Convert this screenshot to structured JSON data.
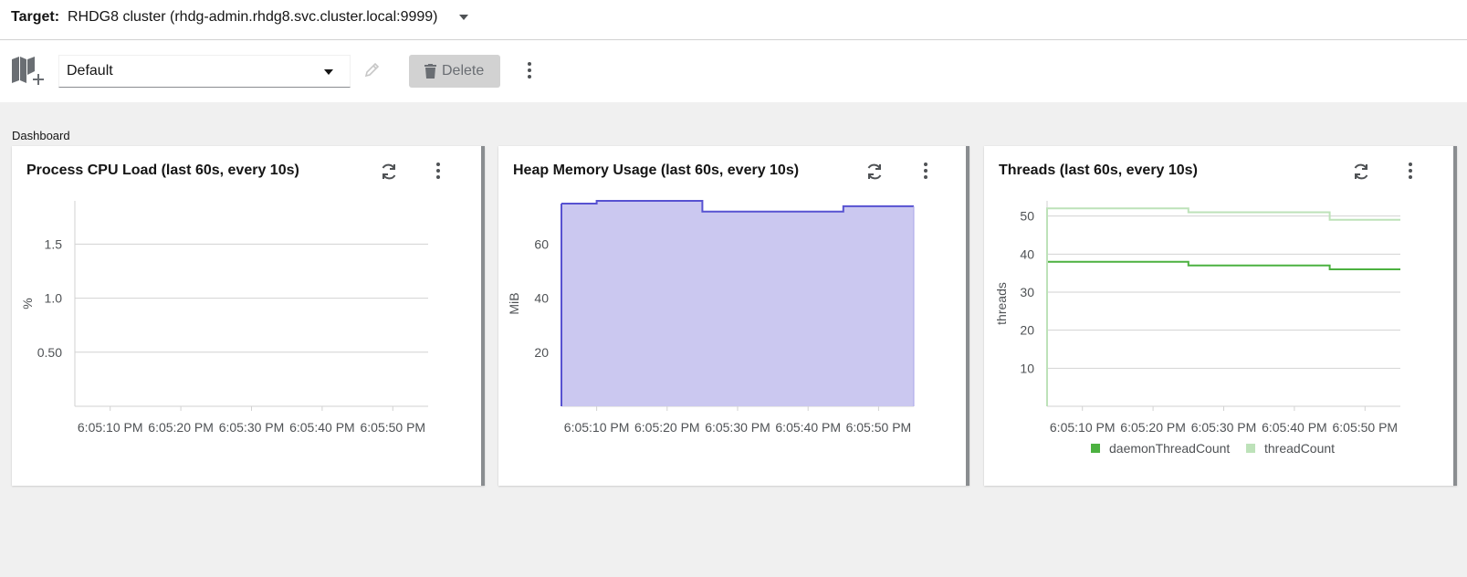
{
  "target": {
    "label": "Target:",
    "value": "RHDG8 cluster (rhdg-admin.rhdg8.svc.cluster.local:9999)"
  },
  "toolbar": {
    "layout_value": "Default",
    "delete_label": "Delete"
  },
  "dashboard_label": "Dashboard",
  "icons": [
    "layout-library-icon",
    "caret-down-icon",
    "pencil-icon",
    "trash-icon",
    "kebab-icon",
    "refresh-icon"
  ],
  "colors": {
    "heap_fill": "#cbc8f0",
    "heap_line": "#5752d1",
    "daemon_threads": "#4cb140",
    "thread_count": "#bde2b9",
    "disabled_button": "#d2d2d2"
  },
  "cards": [
    {
      "title": "Process CPU Load (last 60s, every 10s)"
    },
    {
      "title": "Heap Memory Usage (last 60s, every 10s)"
    },
    {
      "title": "Threads (last 60s, every 10s)"
    }
  ],
  "chart_data": [
    {
      "type": "line",
      "title": "Process CPU Load (last 60s, every 10s)",
      "ylabel": "%",
      "yticks": [
        "0.50",
        "1.0",
        "1.5"
      ],
      "ytick_values": [
        0.5,
        1.0,
        1.5
      ],
      "ylim": [
        0,
        1.9
      ],
      "xticks": [
        "6:05:10 PM",
        "6:05:20 PM",
        "6:05:30 PM",
        "6:05:40 PM",
        "6:05:50 PM"
      ],
      "xlim": [
        "6:05:05 PM",
        "6:05:55 PM"
      ],
      "grid": true,
      "series": []
    },
    {
      "type": "area",
      "title": "Heap Memory Usage (last 60s, every 10s)",
      "ylabel": "MiB",
      "yticks": [
        "20",
        "40",
        "60"
      ],
      "ytick_values": [
        20,
        40,
        60
      ],
      "ylim": [
        0,
        76
      ],
      "xticks": [
        "6:05:10 PM",
        "6:05:20 PM",
        "6:05:30 PM",
        "6:05:40 PM",
        "6:05:50 PM"
      ],
      "xlim": [
        "6:05:05 PM",
        "6:05:55 PM"
      ],
      "grid": true,
      "interpolation": "step",
      "series": [
        {
          "x": [
            "6:05:05 PM",
            "6:05:10 PM",
            "6:05:20 PM",
            "6:05:25 PM",
            "6:05:45 PM",
            "6:05:55 PM"
          ],
          "values": [
            75,
            76,
            76,
            72,
            74,
            74
          ]
        }
      ]
    },
    {
      "type": "line",
      "title": "Threads (last 60s, every 10s)",
      "ylabel": "threads",
      "yticks": [
        "10",
        "20",
        "30",
        "40",
        "50"
      ],
      "ytick_values": [
        10,
        20,
        30,
        40,
        50
      ],
      "ylim": [
        0,
        54
      ],
      "xticks": [
        "6:05:10 PM",
        "6:05:20 PM",
        "6:05:30 PM",
        "6:05:40 PM",
        "6:05:50 PM"
      ],
      "xlim": [
        "6:05:05 PM",
        "6:05:55 PM"
      ],
      "grid": true,
      "interpolation": "step",
      "legend_position": "bottom",
      "series": [
        {
          "name": "daemonThreadCount",
          "x": [
            "6:05:05 PM",
            "6:05:25 PM",
            "6:05:45 PM",
            "6:05:55 PM"
          ],
          "values": [
            38,
            37,
            36,
            36
          ]
        },
        {
          "name": "threadCount",
          "x": [
            "6:05:05 PM",
            "6:05:25 PM",
            "6:05:45 PM",
            "6:05:55 PM"
          ],
          "values": [
            52,
            51,
            49,
            49
          ]
        }
      ]
    }
  ]
}
